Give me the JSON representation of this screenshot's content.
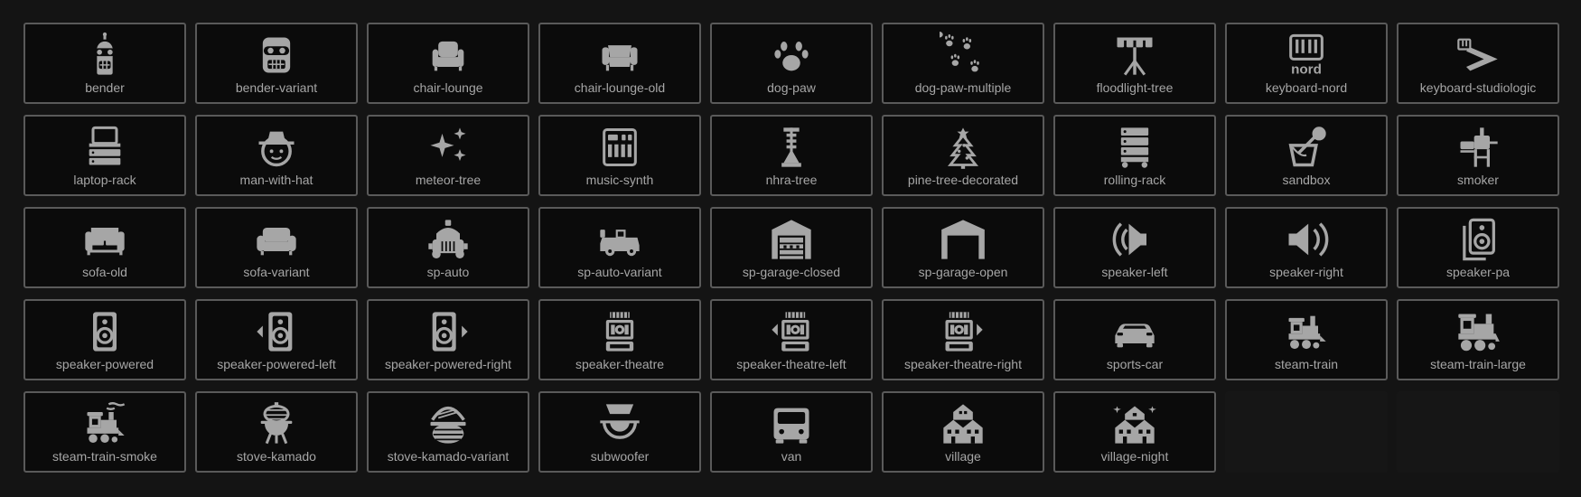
{
  "icons": [
    {
      "name": "bender",
      "icon": "bender-icon"
    },
    {
      "name": "bender-variant",
      "icon": "bender-variant-icon"
    },
    {
      "name": "chair-lounge",
      "icon": "chair-lounge-icon"
    },
    {
      "name": "chair-lounge-old",
      "icon": "chair-lounge-old-icon"
    },
    {
      "name": "dog-paw",
      "icon": "dog-paw-icon"
    },
    {
      "name": "dog-paw-multiple",
      "icon": "dog-paw-multiple-icon"
    },
    {
      "name": "floodlight-tree",
      "icon": "floodlight-tree-icon"
    },
    {
      "name": "keyboard-nord",
      "icon": "keyboard-nord-icon"
    },
    {
      "name": "keyboard-studiologic",
      "icon": "keyboard-studiologic-icon"
    },
    {
      "name": "laptop-rack",
      "icon": "laptop-rack-icon"
    },
    {
      "name": "man-with-hat",
      "icon": "man-with-hat-icon"
    },
    {
      "name": "meteor-tree",
      "icon": "meteor-tree-icon"
    },
    {
      "name": "music-synth",
      "icon": "music-synth-icon"
    },
    {
      "name": "nhra-tree",
      "icon": "nhra-tree-icon"
    },
    {
      "name": "pine-tree-decorated",
      "icon": "pine-tree-decorated-icon"
    },
    {
      "name": "rolling-rack",
      "icon": "rolling-rack-icon"
    },
    {
      "name": "sandbox",
      "icon": "sandbox-icon"
    },
    {
      "name": "smoker",
      "icon": "smoker-icon"
    },
    {
      "name": "sofa-old",
      "icon": "sofa-old-icon"
    },
    {
      "name": "sofa-variant",
      "icon": "sofa-variant-icon"
    },
    {
      "name": "sp-auto",
      "icon": "sp-auto-icon"
    },
    {
      "name": "sp-auto-variant",
      "icon": "sp-auto-variant-icon"
    },
    {
      "name": "sp-garage-closed",
      "icon": "sp-garage-closed-icon"
    },
    {
      "name": "sp-garage-open",
      "icon": "sp-garage-open-icon"
    },
    {
      "name": "speaker-left",
      "icon": "speaker-left-icon"
    },
    {
      "name": "speaker-right",
      "icon": "speaker-right-icon"
    },
    {
      "name": "speaker-pa",
      "icon": "speaker-pa-icon"
    },
    {
      "name": "speaker-powered",
      "icon": "speaker-powered-icon"
    },
    {
      "name": "speaker-powered-left",
      "icon": "speaker-powered-left-icon"
    },
    {
      "name": "speaker-powered-right",
      "icon": "speaker-powered-right-icon"
    },
    {
      "name": "speaker-theatre",
      "icon": "speaker-theatre-icon"
    },
    {
      "name": "speaker-theatre-left",
      "icon": "speaker-theatre-left-icon"
    },
    {
      "name": "speaker-theatre-right",
      "icon": "speaker-theatre-right-icon"
    },
    {
      "name": "sports-car",
      "icon": "sports-car-icon"
    },
    {
      "name": "steam-train",
      "icon": "steam-train-icon"
    },
    {
      "name": "steam-train-large",
      "icon": "steam-train-large-icon"
    },
    {
      "name": "steam-train-smoke",
      "icon": "steam-train-smoke-icon"
    },
    {
      "name": "stove-kamado",
      "icon": "stove-kamado-icon"
    },
    {
      "name": "stove-kamado-variant",
      "icon": "stove-kamado-variant-icon"
    },
    {
      "name": "subwoofer",
      "icon": "subwoofer-icon"
    },
    {
      "name": "van",
      "icon": "van-icon"
    },
    {
      "name": "village",
      "icon": "village-icon"
    },
    {
      "name": "village-night",
      "icon": "village-night-icon"
    }
  ],
  "nord_logo_text": "nord",
  "colors": {
    "background": "#141414",
    "tile_background": "#0b0b0b",
    "tile_border": "#5a5a5a",
    "icon": "#a6a6a6",
    "label": "#a6a6a6"
  }
}
